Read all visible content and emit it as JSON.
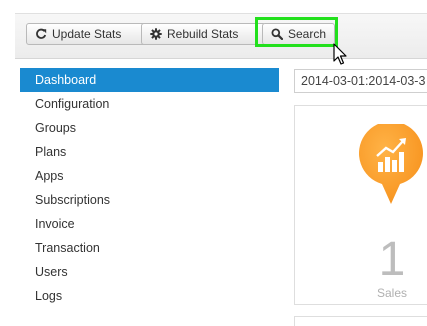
{
  "toolbar": {
    "update_stats_label": "Update Stats",
    "rebuild_stats_label": "Rebuild Stats",
    "search_label": "Search"
  },
  "sidebar": {
    "items": [
      {
        "label": "Dashboard",
        "active": true
      },
      {
        "label": "Configuration"
      },
      {
        "label": "Groups"
      },
      {
        "label": "Plans"
      },
      {
        "label": "Apps"
      },
      {
        "label": "Subscriptions"
      },
      {
        "label": "Invoice"
      },
      {
        "label": "Transaction"
      },
      {
        "label": "Users"
      },
      {
        "label": "Logs"
      }
    ]
  },
  "main": {
    "date_range": "2014-03-01:2014-03-3",
    "sales_card": {
      "value": "1",
      "label": "Sales",
      "icon": "growth-chart-icon",
      "accent_color": "#f7931e"
    }
  },
  "colors": {
    "active_nav": "#1a8ad0",
    "highlight": "#22e01c"
  }
}
